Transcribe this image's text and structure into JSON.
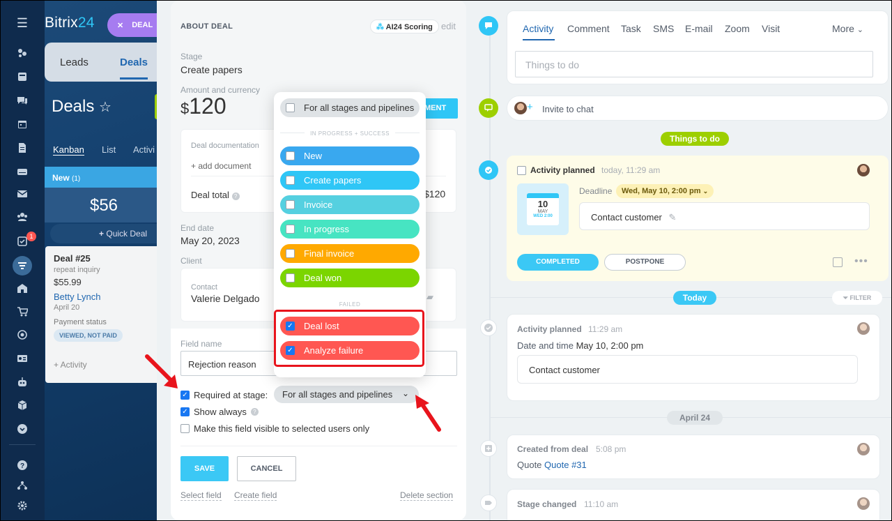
{
  "brand": {
    "name": "Bitrix",
    "suffix": "24"
  },
  "deal_pill": "DEAL",
  "bg_tabs": [
    "Leads",
    "Deals"
  ],
  "bg_title": "Deals",
  "bg_views": [
    "Kanban",
    "List",
    "Activi"
  ],
  "bg_column": {
    "name": "New",
    "count": "(1)",
    "sum": "$56",
    "quick": "Quick Deal"
  },
  "bg_card": {
    "title": "Deal #25",
    "subtitle": "repeat inquiry",
    "amount": "$55.99",
    "contact": "Betty Lynch",
    "date": "April 20",
    "payment_label": "Payment status",
    "payment_badge": "VIEWED, NOT PAID",
    "activity": "+ Activity"
  },
  "rail": {
    "tasks_badge": "1"
  },
  "form": {
    "section_title": "ABOUT DEAL",
    "ai_scoring": "AI24 Scoring",
    "edit": "edit",
    "stage_label": "Stage",
    "stage_value": "Create papers",
    "amount_label": "Amount and currency",
    "currency_sign": "$",
    "amount_value": "120",
    "payment_button": "MENT",
    "doc_label": "Deal documentation",
    "add_document": "+ add document",
    "deal_total_label": "Deal total",
    "deal_total_value": "$120",
    "enddate_label": "End date",
    "enddate_value": "May 20, 2023",
    "client_label": "Client",
    "contact_label": "Contact",
    "contact_value": "Valerie Delgado",
    "field_name_label": "Field name",
    "field_name_value": "Rejection reason",
    "required_label": "Required at stage:",
    "required_select": "For all stages and pipelines",
    "show_always": "Show always",
    "visible_selected": "Make this field visible to selected users only",
    "save": "SAVE",
    "cancel": "CANCEL",
    "select_field": "Select field",
    "create_field": "Create field",
    "delete_section": "Delete section"
  },
  "dropdown": {
    "all": "For all stages and pipelines",
    "group_progress": "IN PROGRESS + SUCCESS",
    "group_failed": "FAILED",
    "options": [
      {
        "label": "New",
        "color": "#39a8ef",
        "checked": false
      },
      {
        "label": "Create papers",
        "color": "#2fc6f6",
        "checked": false
      },
      {
        "label": "Invoice",
        "color": "#55d0e0",
        "checked": false
      },
      {
        "label": "In progress",
        "color": "#47e4c2",
        "checked": false
      },
      {
        "label": "Final invoice",
        "color": "#ffa900",
        "checked": false
      },
      {
        "label": "Deal won",
        "color": "#7bd500",
        "checked": false
      },
      {
        "label": "Deal lost",
        "color": "#ff5752",
        "checked": true
      },
      {
        "label": "Analyze failure",
        "color": "#ff5752",
        "checked": true
      }
    ]
  },
  "timeline": {
    "tabs": [
      "Activity",
      "Comment",
      "Task",
      "SMS",
      "E-mail",
      "Zoom",
      "Visit"
    ],
    "more": "More",
    "todo_placeholder": "Things to do",
    "invite_chat": "Invite to chat",
    "things_badge": "Things to do",
    "planned": {
      "title": "Activity planned",
      "time": "today, 11:29 am",
      "deadline_label": "Deadline",
      "deadline_value": "Wed, May 10, 2:00 pm",
      "cal_day": "10",
      "cal_month": "MAY",
      "cal_time": "WED 2:00",
      "text": "Contact customer",
      "completed": "COMPLETED",
      "postpone": "POSTPONE"
    },
    "today_badge": "Today",
    "filter": "FILTER",
    "past": {
      "title": "Activity planned",
      "time": "11:29 am",
      "date_label": "Date and time",
      "date_value": "May 10, 2:00 pm",
      "text": "Contact customer"
    },
    "april_badge": "April 24",
    "created": {
      "title": "Created from deal",
      "time": "5:08 pm",
      "quote_label": "Quote",
      "quote_link": "Quote #31"
    },
    "stage": {
      "title": "Stage changed",
      "time": "11:10 am"
    }
  }
}
